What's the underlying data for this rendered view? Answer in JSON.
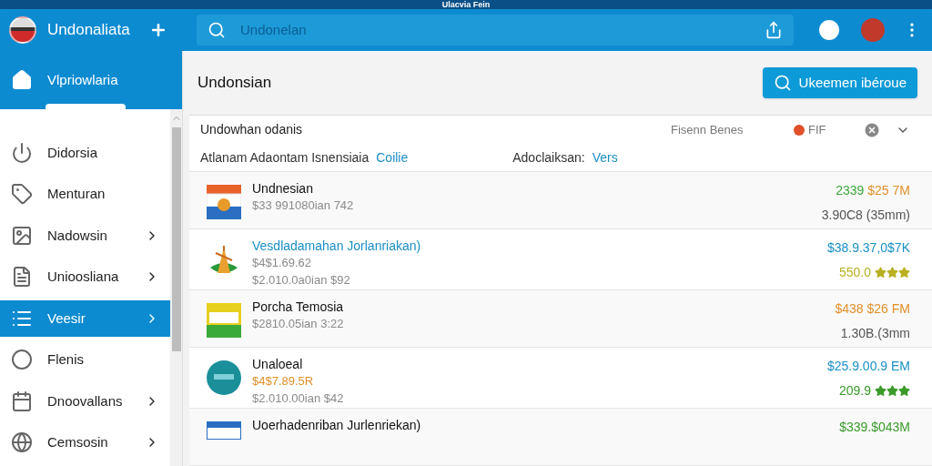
{
  "window": {
    "title": "Ulacvia Fein"
  },
  "header": {
    "app_name": "Undonaliata",
    "search": {
      "placeholder": "Undonelan"
    }
  },
  "sidebar": {
    "top_item": {
      "label": "Vlpriowlaria"
    },
    "items": [
      {
        "label": "Didorsia",
        "chevron": false,
        "selected": false
      },
      {
        "label": "Menturan",
        "chevron": false,
        "selected": false
      },
      {
        "label": "Nadowsin",
        "chevron": true,
        "selected": false
      },
      {
        "label": "Unioosliana",
        "chevron": true,
        "selected": false
      },
      {
        "label": "Veesir",
        "chevron": true,
        "selected": true
      },
      {
        "label": "Flenis",
        "chevron": false,
        "selected": false
      },
      {
        "label": "Dnoovallans",
        "chevron": true,
        "selected": false
      },
      {
        "label": "Cemsosin",
        "chevron": true,
        "selected": false
      }
    ]
  },
  "main": {
    "title": "Undonsian",
    "action_button": "Ukeemen ibéroue",
    "filter": {
      "label": "Undowhan odanis",
      "sort": "Fisenn Benes",
      "status": {
        "label": "FIF",
        "color": "#e0502a"
      },
      "left_text": "Atlanam Adaontam Isnensiaia",
      "left_link": "Coilie",
      "right_text": "Adoclaiksan:",
      "right_link": "Vers"
    },
    "items": [
      {
        "kind": "flag",
        "title": "Undnesian",
        "highlighted": false,
        "lines": [
          {
            "text": "$33 991080ian 742",
            "color": "#8a8a8a"
          }
        ],
        "right": [
          [
            {
              "text": "2339",
              "color": "#3aa83a"
            },
            {
              "text": "$25 7M",
              "color": "#e0902a"
            }
          ],
          [
            {
              "text": "3.90C8 (35mm)",
              "color": "#555555"
            }
          ]
        ]
      },
      {
        "kind": "plant",
        "title": "Vesdladamahan Jorlanriakan)",
        "highlighted": true,
        "lines": [
          {
            "text": "$4$1.69.62",
            "color": "#8a8a8a"
          },
          {
            "text": "$2.010.0a0ian $92",
            "color": "#8a8a8a"
          }
        ],
        "right": [
          [
            {
              "text": "$38.9.37,0$7K",
              "color": "#1a8fc7"
            }
          ],
          [
            {
              "text": "550.0",
              "color": "#b8b020"
            }
          ]
        ],
        "stars": 3
      },
      {
        "kind": "ticket",
        "title": "Porcha Temosia",
        "highlighted": false,
        "lines": [
          {
            "text": "$2810.05ian 3:22",
            "color": "#8a8a8a"
          }
        ],
        "right": [
          [
            {
              "text": "$438 $26 FM",
              "color": "#e0902a"
            }
          ],
          [
            {
              "text": "1.30B.(3mm",
              "color": "#555555"
            }
          ]
        ]
      },
      {
        "kind": "badge",
        "title": "Unaloeal",
        "highlighted": false,
        "lines": [
          {
            "text": "$4$7.89.5R",
            "color": "#e0902a"
          },
          {
            "text": "$2.010.00ian $42",
            "color": "#8a8a8a"
          }
        ],
        "right": [
          [
            {
              "text": "$25.9.00.9 EM",
              "color": "#1a8fc7"
            }
          ],
          [
            {
              "text": "209.9",
              "color": "#3a9a2a"
            }
          ]
        ],
        "stars": 3
      },
      {
        "kind": "card",
        "title": "Uoerhadenriban Jurlenriekan)",
        "highlighted": false,
        "right": [
          [
            {
              "text": "$339.$043M",
              "color": "#3a9a2a"
            }
          ]
        ]
      }
    ]
  }
}
